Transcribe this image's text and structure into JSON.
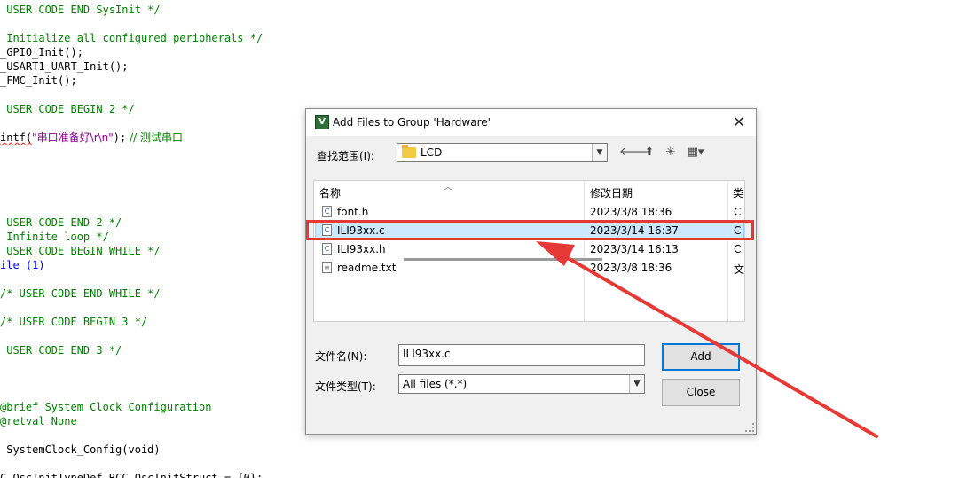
{
  "editor": {
    "lines": [
      {
        "text": " USER CODE END SysInit */",
        "color": "green"
      },
      {
        "text": " Initialize all configured peripherals */",
        "color": "green"
      },
      {
        "text": "_GPIO_Init();",
        "color": "black"
      },
      {
        "text": "_USART1_UART_Init();",
        "color": "black"
      },
      {
        "text": "_FMC_Init();",
        "color": "black"
      },
      {
        "text": " USER CODE BEGIN 2 */",
        "color": "green"
      },
      {
        "text": "intf(",
        "color": "black"
      },
      {
        "text": " USER CODE END 2 */",
        "color": "green"
      },
      {
        "text": " Infinite loop */",
        "color": "green"
      },
      {
        "text": " USER CODE BEGIN WHILE */",
        "color": "green"
      },
      {
        "text": "ile (1)",
        "color": "black"
      },
      {
        "text": "/* USER CODE END WHILE */",
        "color": "green"
      },
      {
        "text": "/* USER CODE BEGIN 3 */",
        "color": "green"
      },
      {
        "text": " USER CODE END 3 */",
        "color": "green"
      },
      {
        "text": "@brief System Clock Configuration",
        "color": "green"
      },
      {
        "text": "@retval None",
        "color": "green"
      },
      {
        "text": " SystemClock_Config(void)",
        "color": "black"
      },
      {
        "text": "C_OscInitTypeDef RCC_OscInitStruct = {0};",
        "color": "black"
      }
    ],
    "printf_string": "\"串口准备好\\r\\n\"",
    "printf_tail": ");",
    "printf_comment": " // 测试串口"
  },
  "dialog": {
    "title": "Add Files to Group 'Hardware'",
    "close_glyph": "✕",
    "look_in_label": "查找范围(I):",
    "look_in_value": "LCD",
    "toolbar": {
      "back": "🡐",
      "up": "⬆",
      "new_folder": "✳",
      "view": "▦▾"
    },
    "columns": [
      "名称",
      "修改日期",
      "类"
    ],
    "files": [
      {
        "name": "font.h",
        "date": "2023/3/8 18:36",
        "type": "C I",
        "icon": "c",
        "selected": false
      },
      {
        "name": "ILI93xx.c",
        "date": "2023/3/14 16:37",
        "type": "C i",
        "icon": "c",
        "selected": true
      },
      {
        "name": "ILI93xx.h",
        "date": "2023/3/14 16:13",
        "type": "C I",
        "icon": "c",
        "selected": false
      },
      {
        "name": "readme.txt",
        "date": "2023/3/8 18:36",
        "type": "文",
        "icon": "txt",
        "selected": false
      }
    ],
    "file_name_label": "文件名(N):",
    "file_name_value": "ILI93xx.c",
    "file_type_label": "文件类型(T):",
    "file_type_value": "All files (*.*)",
    "add_button": "Add",
    "close_button": "Close"
  },
  "annotation": {
    "color": "#e53935"
  }
}
